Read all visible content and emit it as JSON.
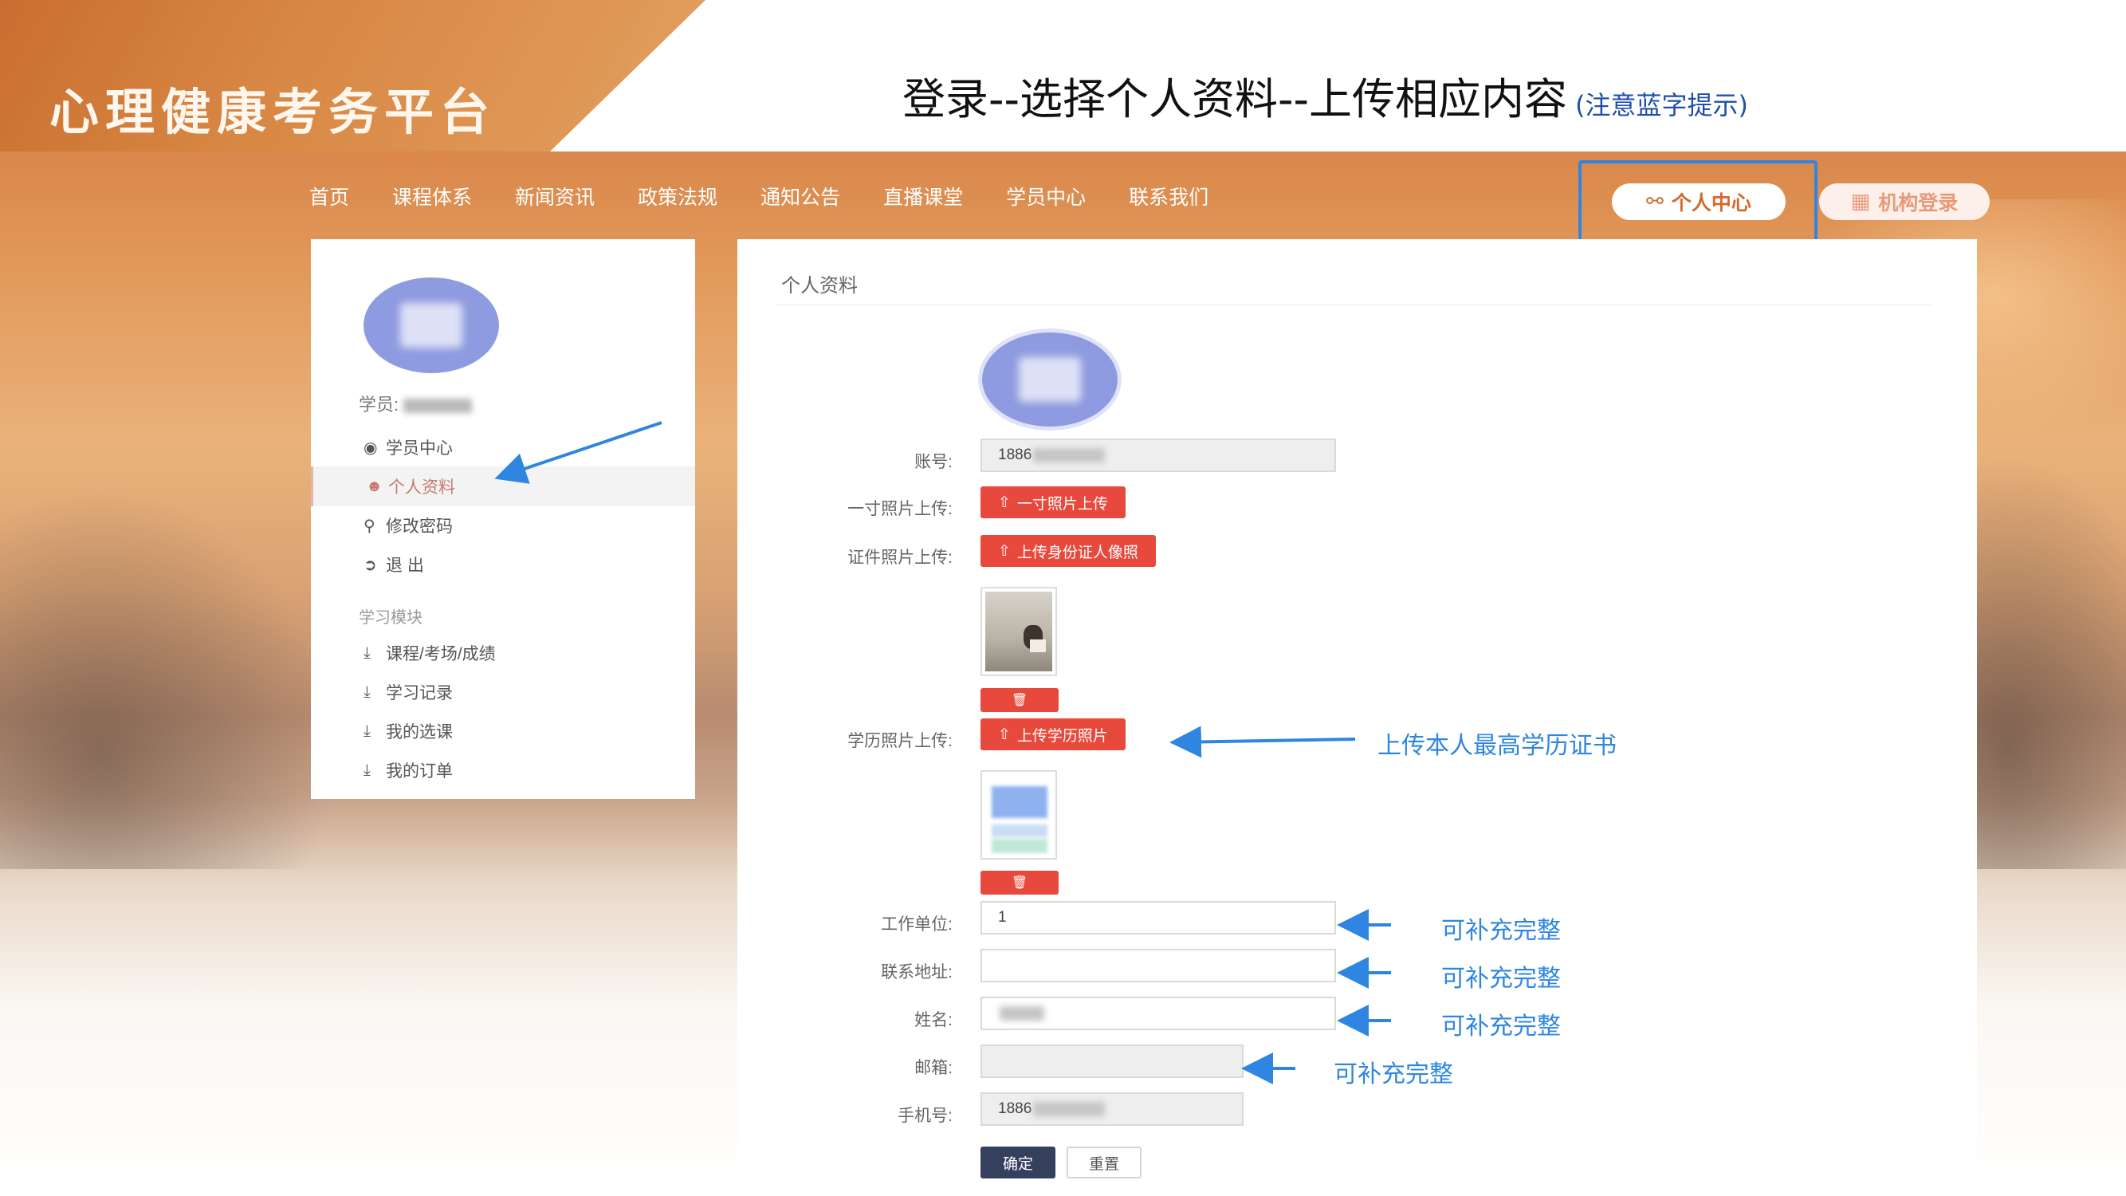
{
  "slide": {
    "brand": "心理健康考务平台",
    "title": "登录--选择个人资料--上传相应内容",
    "title_hint": "(注意蓝字提示)"
  },
  "nav": {
    "items": [
      "首页",
      "课程体系",
      "新闻资讯",
      "政策法规",
      "通知公告",
      "直播课堂",
      "学员中心",
      "联系我们"
    ],
    "personal_center": "个人中心",
    "org_login": "机构登录"
  },
  "sidebar": {
    "user_label": "学员:",
    "items": [
      {
        "label": "学员中心",
        "icon": "user-circle-icon"
      },
      {
        "label": "个人资料",
        "icon": "person-icon"
      },
      {
        "label": "修改密码",
        "icon": "key-icon"
      },
      {
        "label": "退 出",
        "icon": "sign-out-icon"
      }
    ],
    "section_title": "学习模块",
    "module_items": [
      {
        "label": "课程/考场/成绩",
        "icon": "download-icon"
      },
      {
        "label": "学习记录",
        "icon": "download-icon"
      },
      {
        "label": "我的选课",
        "icon": "download-icon"
      },
      {
        "label": "我的订单",
        "icon": "download-icon"
      }
    ]
  },
  "panel": {
    "title": "个人资料",
    "account_label": "账号:",
    "account_value": "1886",
    "photo_label": "一寸照片上传:",
    "photo_button": "一寸照片上传",
    "id_label": "证件照片上传:",
    "id_button": "上传身份证人像照",
    "edu_label": "学历照片上传:",
    "edu_button": "上传学历照片",
    "work_label": "工作单位:",
    "work_value": "1",
    "address_label": "联系地址:",
    "address_value": "",
    "name_label": "姓名:",
    "email_label": "邮箱:",
    "email_value": "",
    "phone_label": "手机号:",
    "phone_value": "1886",
    "submit_label": "确定",
    "reset_label": "重置"
  },
  "annotations": {
    "edu_hint": "上传本人最高学历证书",
    "fill_hint": "可补充完整"
  },
  "colors": {
    "accent_red": "#e74a3c",
    "annotation_blue": "#2f86e0",
    "submit_navy": "#34405e",
    "avatar_purple": "#8f9be0"
  }
}
